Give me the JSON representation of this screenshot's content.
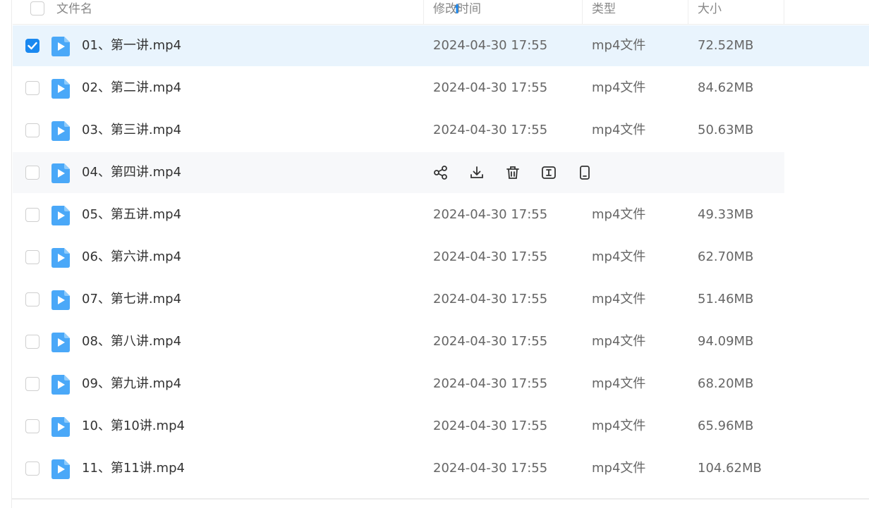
{
  "header": {
    "name_label": "文件名",
    "time_label": "修改时间",
    "type_label": "类型",
    "size_label": "大小"
  },
  "colors": {
    "accent": "#1a88f0",
    "selected_row_bg": "#e9f4fd",
    "hover_row_bg": "#f7f8fa",
    "video_icon": "#4aa8f8"
  },
  "files": [
    {
      "name": "01、第一讲.mp4",
      "time": "2024-04-30 17:55",
      "type": "mp4文件",
      "size": "72.52MB",
      "checked": true
    },
    {
      "name": "02、第二讲.mp4",
      "time": "2024-04-30 17:55",
      "type": "mp4文件",
      "size": "84.62MB"
    },
    {
      "name": "03、第三讲.mp4",
      "time": "2024-04-30 17:55",
      "type": "mp4文件",
      "size": "50.63MB"
    },
    {
      "name": "04、第四讲.mp4",
      "hovered": true
    },
    {
      "name": "05、第五讲.mp4",
      "time": "2024-04-30 17:55",
      "type": "mp4文件",
      "size": "49.33MB"
    },
    {
      "name": "06、第六讲.mp4",
      "time": "2024-04-30 17:55",
      "type": "mp4文件",
      "size": "62.70MB"
    },
    {
      "name": "07、第七讲.mp4",
      "time": "2024-04-30 17:55",
      "type": "mp4文件",
      "size": "51.46MB"
    },
    {
      "name": "08、第八讲.mp4",
      "time": "2024-04-30 17:55",
      "type": "mp4文件",
      "size": "94.09MB"
    },
    {
      "name": "09、第九讲.mp4",
      "time": "2024-04-30 17:55",
      "type": "mp4文件",
      "size": "68.20MB"
    },
    {
      "name": "10、第10讲.mp4",
      "time": "2024-04-30 17:55",
      "type": "mp4文件",
      "size": "65.96MB"
    },
    {
      "name": "11、第11讲.mp4",
      "time": "2024-04-30 17:55",
      "type": "mp4文件",
      "size": "104.62MB"
    }
  ],
  "row_actions": [
    "share-icon",
    "download-icon",
    "delete-icon",
    "rename-icon",
    "send-to-phone-icon"
  ]
}
